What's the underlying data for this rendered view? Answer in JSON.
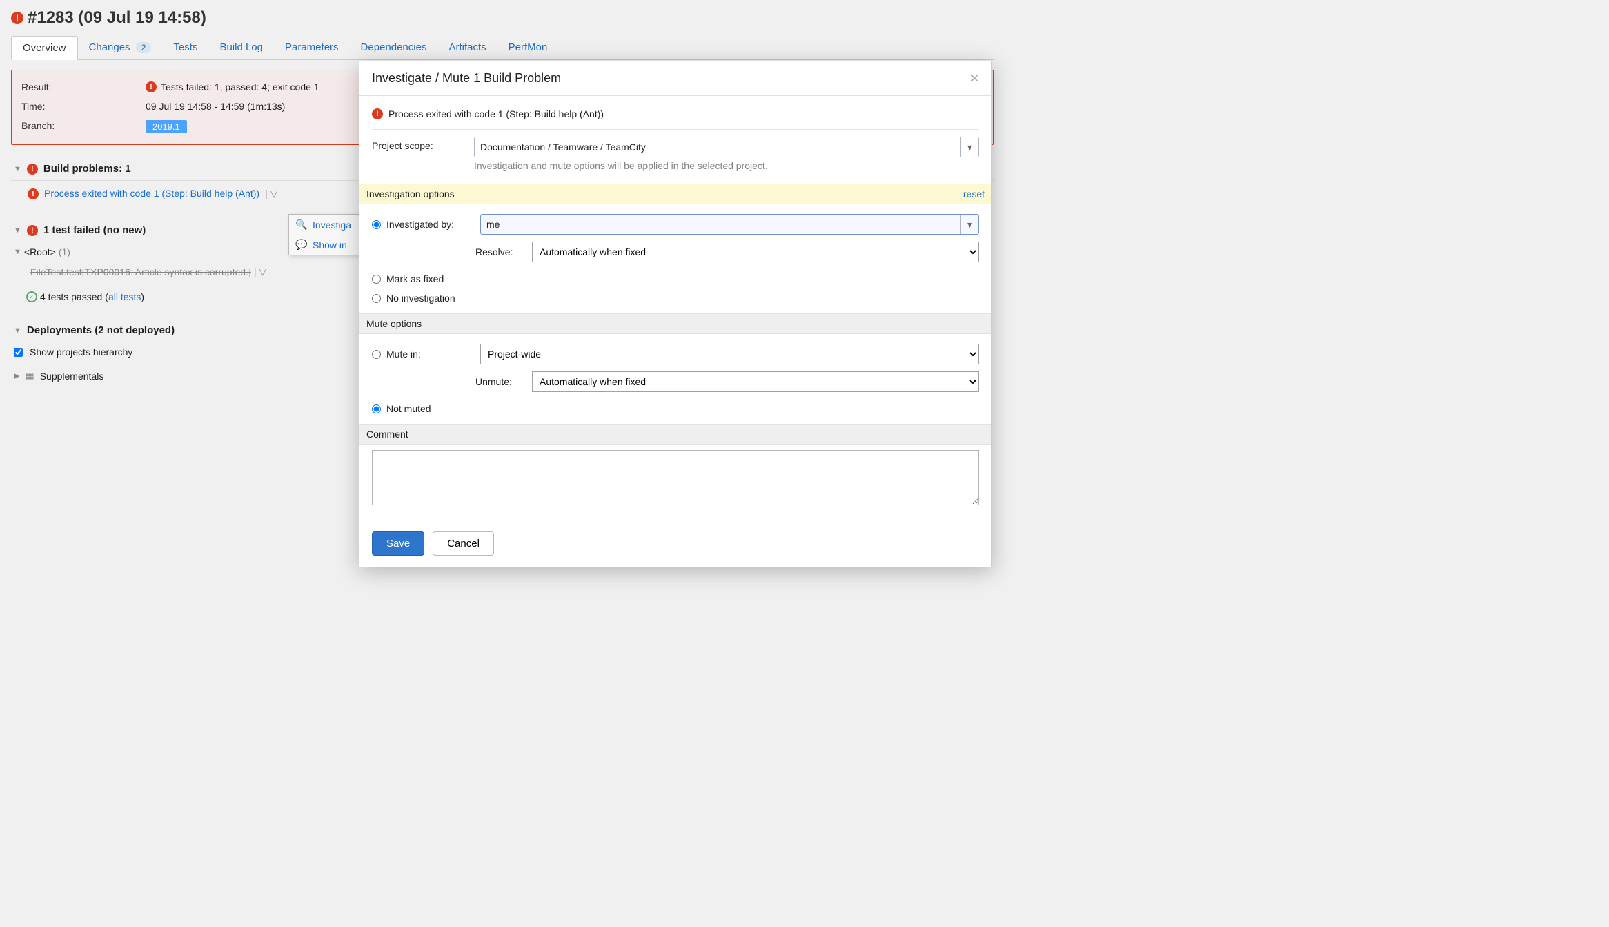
{
  "page_title": "#1283 (09 Jul 19 14:58)",
  "tabs": {
    "overview": "Overview",
    "changes": "Changes",
    "changes_count": "2",
    "tests": "Tests",
    "build_log": "Build Log",
    "parameters": "Parameters",
    "dependencies": "Dependencies",
    "artifacts": "Artifacts",
    "perfmon": "PerfMon"
  },
  "result": {
    "label": "Result:",
    "value": "Tests failed: 1, passed: 4; exit code 1",
    "time_label": "Time:",
    "time_value": "09 Jul 19 14:58 - 14:59 (1m:13s)",
    "branch_label": "Branch:",
    "branch_value": "2019.1"
  },
  "build_problems": {
    "header": "Build problems: 1",
    "item": "Process exited with code 1 (Step: Build help (Ant))"
  },
  "context_menu": {
    "investigate": "Investiga",
    "show_in": "Show in"
  },
  "tests_failed": {
    "header": "1 test failed (no new)",
    "root": "<Root>",
    "root_count": "(1)",
    "failed_test": "FileTest.test[TXP00016: Article syntax is corrupted.]",
    "passed_text": "4 tests passed",
    "all_tests": "all tests"
  },
  "deployments": {
    "header": "Deployments (2 not deployed)",
    "show_hierarchy": "Show projects hierarchy",
    "supplementals": "Supplementals"
  },
  "dialog": {
    "title": "Investigate / Mute 1 Build Problem",
    "problem": "Process exited with code 1 (Step: Build help (Ant))",
    "project_scope_label": "Project scope:",
    "project_scope_value": "Documentation / Teamware / TeamCity",
    "project_scope_hint": "Investigation and mute options will be applied in the selected project.",
    "investigation_header": "Investigation options",
    "reset": "reset",
    "investigated_by_label": "Investigated by:",
    "investigated_by_value": "me",
    "resolve_label": "Resolve:",
    "resolve_value": "Automatically when fixed",
    "mark_as_fixed": "Mark as fixed",
    "no_investigation": "No investigation",
    "mute_header": "Mute options",
    "mute_in_label": "Mute in:",
    "mute_in_value": "Project-wide",
    "unmute_label": "Unmute:",
    "unmute_value": "Automatically when fixed",
    "not_muted": "Not muted",
    "comment_header": "Comment",
    "save": "Save",
    "cancel": "Cancel"
  }
}
